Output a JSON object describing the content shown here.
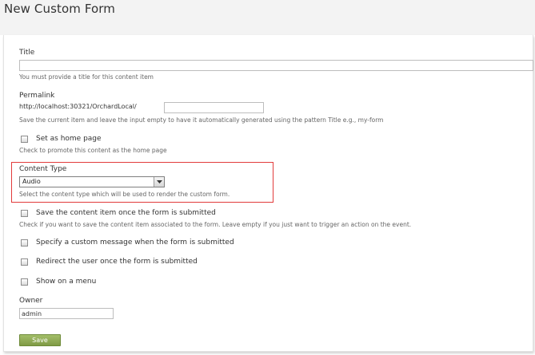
{
  "page": {
    "title": "New Custom Form"
  },
  "fields": {
    "title": {
      "label": "Title",
      "value": "",
      "hint": "You must provide a title for this content item"
    },
    "permalink": {
      "label": "Permalink",
      "prefix": "http://localhost:30321/OrchardLocal/",
      "value": "",
      "hint": "Save the current item and leave the input empty to have it automatically generated using the pattern Title e.g., my-form"
    },
    "homepage": {
      "label": "Set as home page",
      "checked": false,
      "hint": "Check to promote this content as the home page"
    },
    "content_type": {
      "label": "Content Type",
      "selected": "Audio",
      "hint": "Select the content type which will be used to render the custom form."
    },
    "save_item": {
      "label": "Save the content item once the form is submitted",
      "checked": false,
      "hint": "Check if you want to save the content item associated to the form. Leave empty if you just want to trigger an action on the event."
    },
    "custom_message": {
      "label": "Specify a custom message when the form is submitted",
      "checked": false
    },
    "redirect": {
      "label": "Redirect the user once the form is submitted",
      "checked": false
    },
    "show_menu": {
      "label": "Show on a menu",
      "checked": false
    },
    "owner": {
      "label": "Owner",
      "value": "admin"
    }
  },
  "actions": {
    "save_label": "Save"
  },
  "colors": {
    "highlight": "#e23b3b",
    "save_button": "#8fab55",
    "header_bg": "#f3f3f3"
  }
}
